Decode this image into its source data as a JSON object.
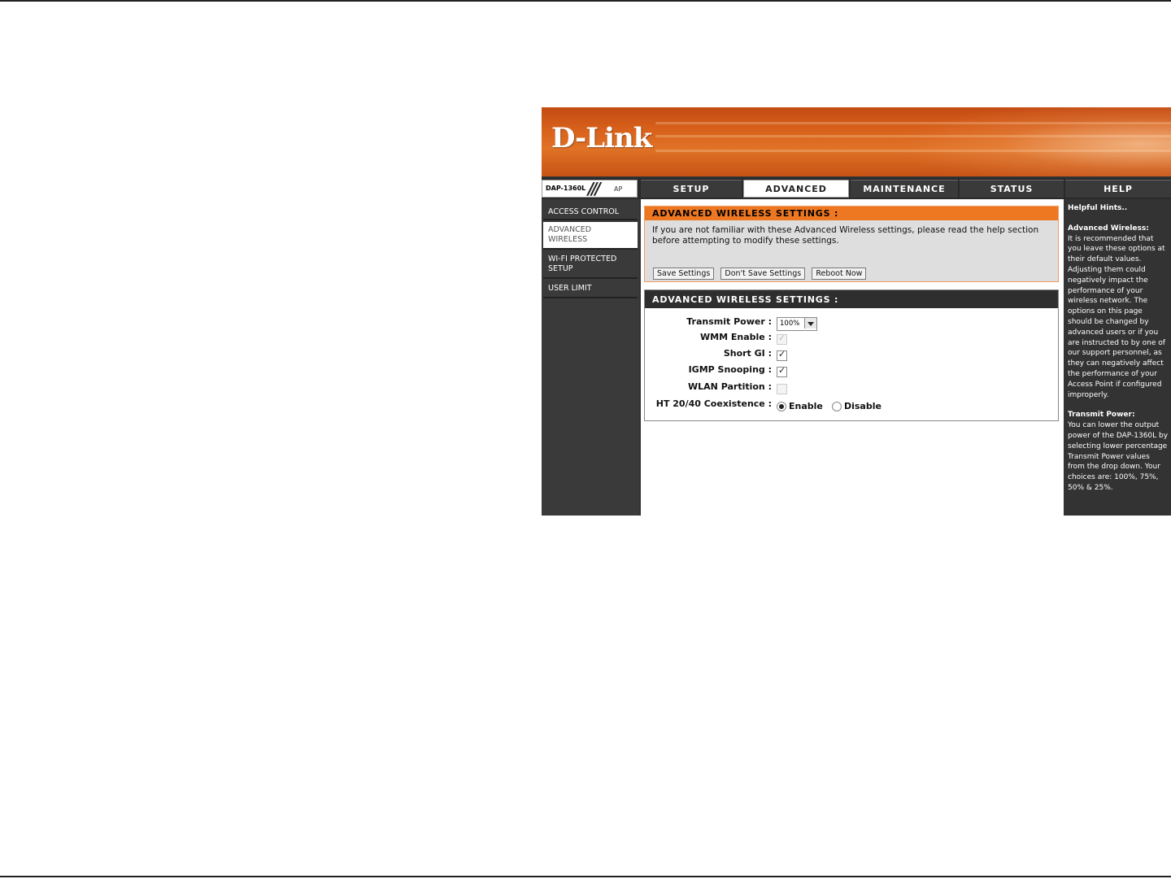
{
  "brand": {
    "logo": "D-Link",
    "model": "DAP-1360L",
    "mode": "AP"
  },
  "tabs": [
    {
      "label": "SETUP"
    },
    {
      "label": "ADVANCED"
    },
    {
      "label": "MAINTENANCE"
    },
    {
      "label": "STATUS"
    },
    {
      "label": "HELP"
    }
  ],
  "sidebar": {
    "items": [
      {
        "label": "ACCESS CONTROL"
      },
      {
        "label": "ADVANCED WIRELESS"
      },
      {
        "label": "WI-FI PROTECTED SETUP"
      },
      {
        "label": "USER LIMIT"
      }
    ]
  },
  "notice": {
    "title": "ADVANCED WIRELESS SETTINGS :",
    "text": "If you are not familiar with these Advanced Wireless settings, please read the help section before attempting to modify these settings.",
    "buttons": {
      "save": "Save Settings",
      "dont_save": "Don't Save Settings",
      "reboot": "Reboot Now"
    }
  },
  "settings": {
    "title": "ADVANCED WIRELESS SETTINGS :",
    "transmit_power": {
      "label": "Transmit Power :",
      "value": "100%"
    },
    "wmm": {
      "label": "WMM Enable :",
      "checked": true,
      "disabled": true
    },
    "short_gi": {
      "label": "Short GI :",
      "checked": true
    },
    "igmp": {
      "label": "IGMP Snooping :",
      "checked": true
    },
    "wlan_partition": {
      "label": "WLAN Partition :",
      "checked": false
    },
    "ht_coexistence": {
      "label": "HT 20/40 Coexistence :",
      "enable": "Enable",
      "disable": "Disable",
      "selected": "Enable"
    }
  },
  "help": {
    "title": "Helpful Hints..",
    "sections": [
      {
        "heading": "Advanced Wireless:",
        "text": "It is recommended that you leave these options at their default values. Adjusting them could negatively impact the performance of your wireless network. The options on this page should be changed by advanced users or if you are instructed to by one of our support personnel, as they can negatively affect the performance of your Access Point if configured improperly."
      },
      {
        "heading": "Transmit Power:",
        "text": "You can lower the output power of the DAP-1360L by selecting lower percentage Transmit Power values from the drop down. Your choices are: 100%, 75%, 50% & 25%."
      }
    ]
  },
  "colors": {
    "accent": "#ee7822",
    "banner": "#d9631c",
    "dark": "#333333"
  }
}
